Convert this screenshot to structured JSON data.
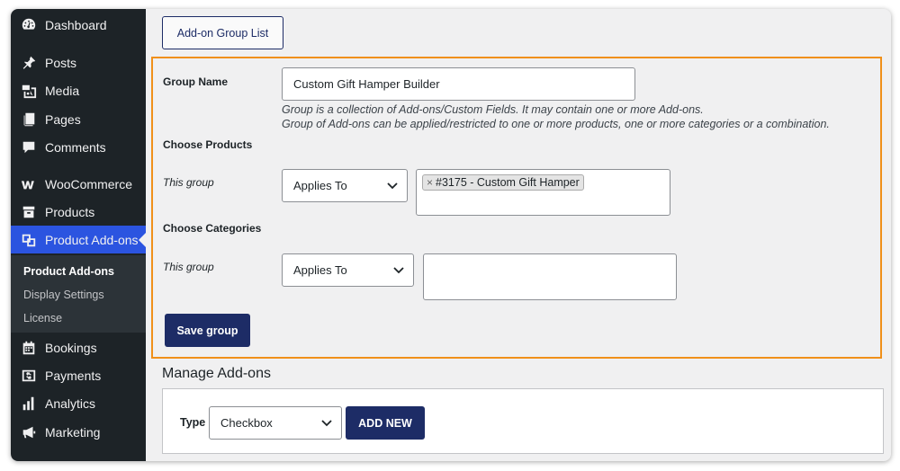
{
  "sidebar": {
    "items": [
      {
        "label": "Dashboard",
        "icon": "dashboard-icon"
      },
      {
        "label": "Posts",
        "icon": "pin-icon"
      },
      {
        "label": "Media",
        "icon": "media-icon"
      },
      {
        "label": "Pages",
        "icon": "pages-icon"
      },
      {
        "label": "Comments",
        "icon": "comment-icon"
      },
      {
        "label": "WooCommerce",
        "icon": "woo-icon"
      },
      {
        "label": "Products",
        "icon": "archive-icon"
      },
      {
        "label": "Product Add-ons",
        "icon": "addons-icon"
      },
      {
        "label": "Bookings",
        "icon": "calendar-icon"
      },
      {
        "label": "Payments",
        "icon": "dollar-icon"
      },
      {
        "label": "Analytics",
        "icon": "bar-chart-icon"
      },
      {
        "label": "Marketing",
        "icon": "megaphone-icon"
      }
    ],
    "submenu": [
      "Product Add-ons",
      "Display Settings",
      "License"
    ]
  },
  "header": {
    "list_button": "Add-on Group List"
  },
  "form": {
    "group_name_label": "Group Name",
    "group_name_value": "Custom Gift Hamper Builder",
    "desc_line1": "Group is a collection of Add-ons/Custom Fields. It may contain one or more Add-ons.",
    "desc_line2": "Group of Add-ons can be applied/restricted to one or more products, one or more categories or a combination.",
    "choose_products_label": "Choose Products",
    "products_row_label": "This group",
    "products_select": "Applies To",
    "products_tag": "#3175 - Custom Gift Hamper",
    "choose_categories_label": "Choose Categories",
    "categories_row_label": "This group",
    "categories_select": "Applies To",
    "save_button": "Save group"
  },
  "manage": {
    "title": "Manage Add-ons",
    "type_label": "Type",
    "type_select": "Checkbox",
    "add_new_button": "ADD NEW"
  },
  "colors": {
    "sidebar_bg": "#1d2327",
    "active_item": "#2b54e0",
    "primary_button": "#1d2c66",
    "highlight_border": "#f0901a"
  }
}
